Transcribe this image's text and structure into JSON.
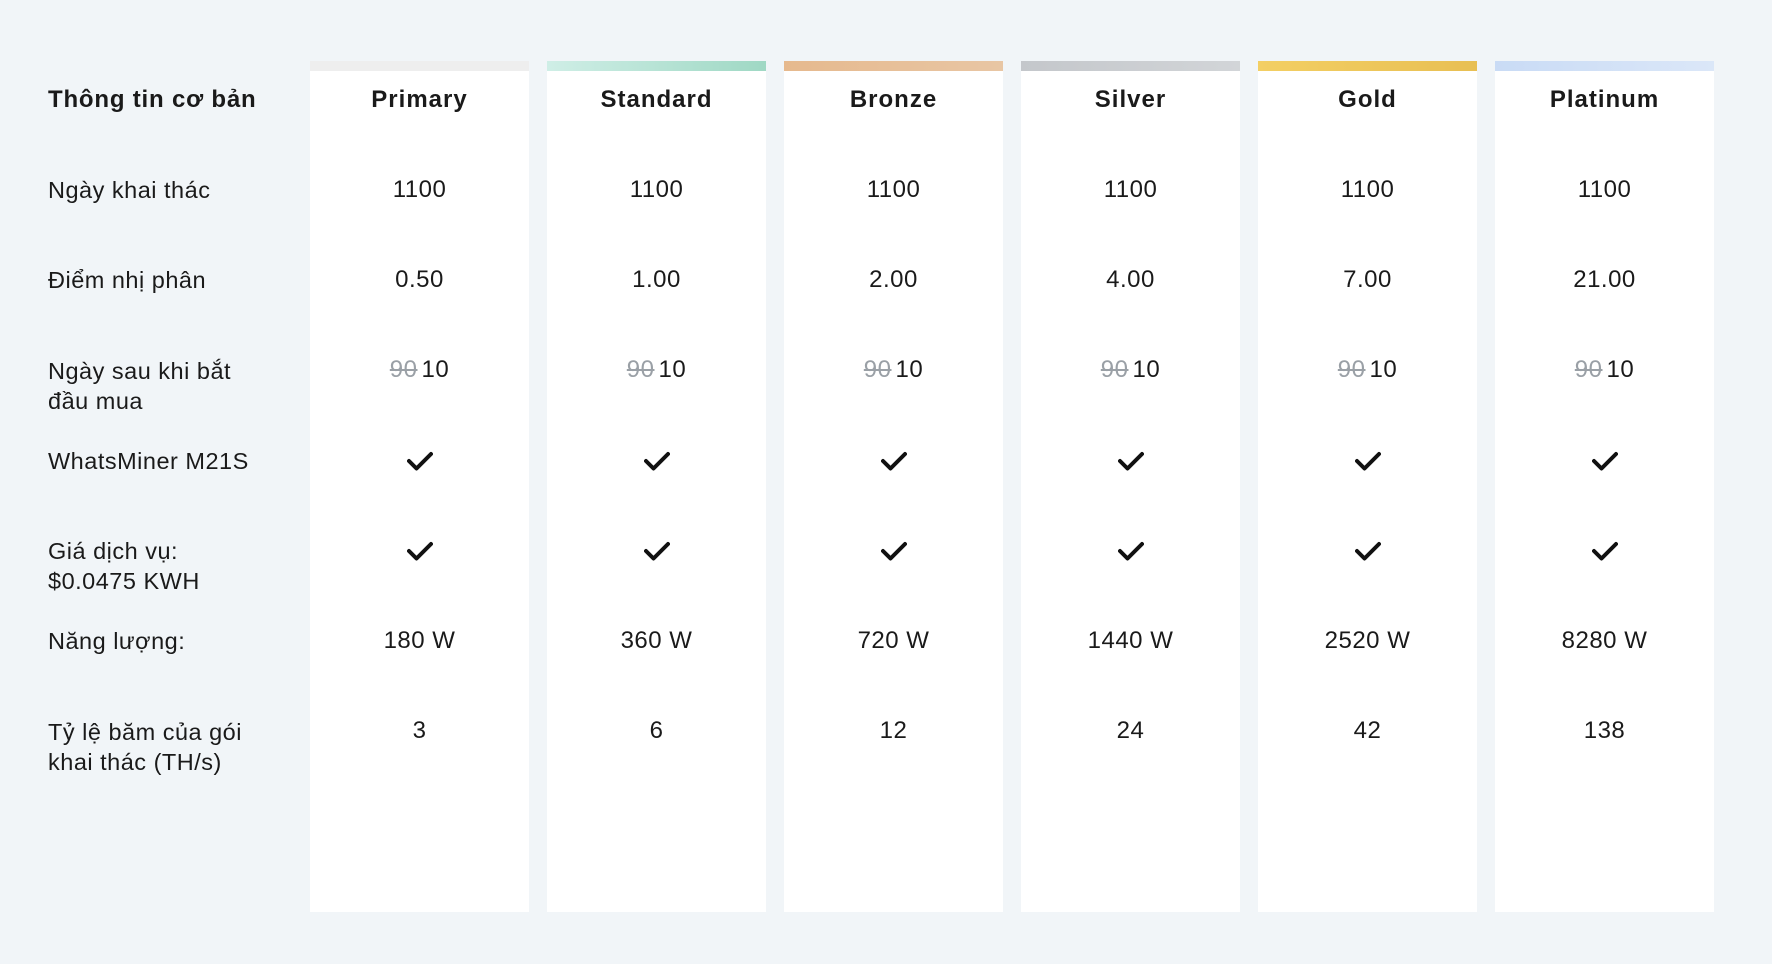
{
  "table": {
    "header_label": "Thông tin cơ bản",
    "row_labels": [
      "Ngày khai thác",
      "Điểm nhị phân",
      "Ngày sau khi bắt đầu mua",
      "WhatsMiner M21S",
      "Giá dịch vụ: $0.0475 KWH",
      "Năng lượng:",
      "Tỷ lệ băm của gói khai thác (TH/s)"
    ],
    "row_label_lines": [
      [
        "Ngày khai thác"
      ],
      [
        "Điểm nhị phân"
      ],
      [
        "Ngày sau khi bắt",
        "đầu mua"
      ],
      [
        "WhatsMiner M21S"
      ],
      [
        "Giá dịch vụ:",
        "$0.0475 KWH"
      ],
      [
        "Năng lượng:"
      ],
      [
        "Tỷ lệ băm của gói",
        "khai thác (TH/s)"
      ]
    ],
    "plans": [
      {
        "name": "Primary",
        "accent": "#eeeeee",
        "mining_days": "1100",
        "binary_points": "0.50",
        "days_old": "90",
        "days_new": "10",
        "whatsminer_included": true,
        "service_fee_included": true,
        "power": "180 W",
        "hashrate": "3"
      },
      {
        "name": "Standard",
        "accent_gradient": [
          "#cfeee6",
          "#9fd8c4"
        ],
        "mining_days": "1100",
        "binary_points": "1.00",
        "days_old": "90",
        "days_new": "10",
        "whatsminer_included": true,
        "service_fee_included": true,
        "power": "360 W",
        "hashrate": "6"
      },
      {
        "name": "Bronze",
        "accent_gradient": [
          "#e6b98e",
          "#e8c6a4"
        ],
        "mining_days": "1100",
        "binary_points": "2.00",
        "days_old": "90",
        "days_new": "10",
        "whatsminer_included": true,
        "service_fee_included": true,
        "power": "720 W",
        "hashrate": "12"
      },
      {
        "name": "Silver",
        "accent_gradient": [
          "#c4c7cb",
          "#d2d5d8"
        ],
        "mining_days": "1100",
        "binary_points": "4.00",
        "days_old": "90",
        "days_new": "10",
        "whatsminer_included": true,
        "service_fee_included": true,
        "power": "1440 W",
        "hashrate": "24"
      },
      {
        "name": "Gold",
        "accent_gradient": [
          "#f3cf64",
          "#e8bf53"
        ],
        "mining_days": "1100",
        "binary_points": "7.00",
        "days_old": "90",
        "days_new": "10",
        "whatsminer_included": true,
        "service_fee_included": true,
        "power": "2520 W",
        "hashrate": "42"
      },
      {
        "name": "Platinum",
        "accent_gradient": [
          "#c9dbf5",
          "#dbe7f8"
        ],
        "mining_days": "1100",
        "binary_points": "21.00",
        "days_old": "90",
        "days_new": "10",
        "whatsminer_included": true,
        "service_fee_included": true,
        "power": "8280 W",
        "hashrate": "138"
      }
    ],
    "check_icon": "check-icon",
    "colors": {
      "background": "#f1f5f8",
      "card": "#ffffff",
      "text": "#1a1a1a",
      "strike": "#9aa0a6"
    }
  }
}
